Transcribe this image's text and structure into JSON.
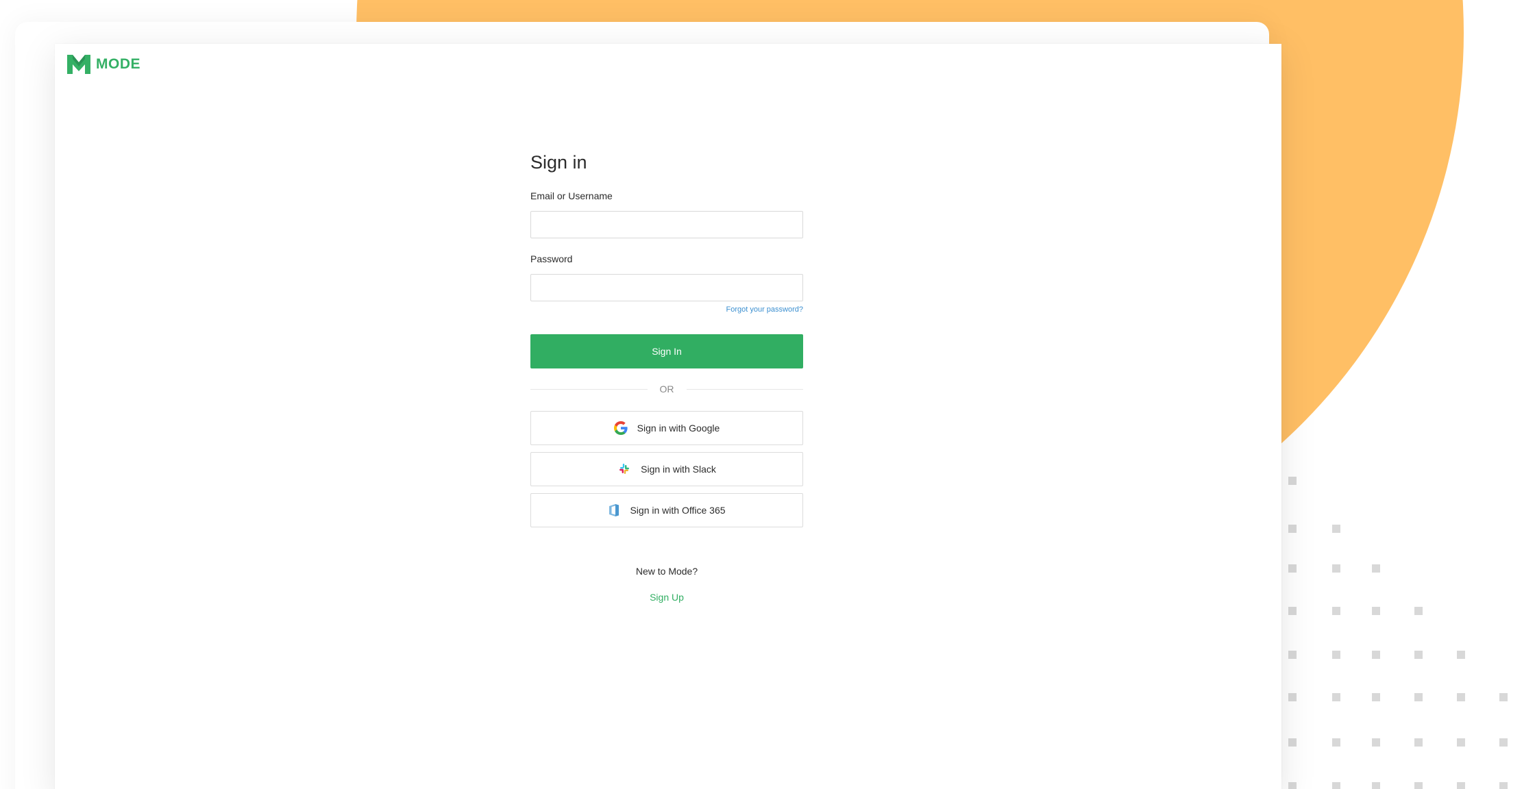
{
  "brand": {
    "name": "MODE",
    "logo_icon": "mode-m-icon",
    "color": "#34b065"
  },
  "sign_in": {
    "title": "Sign in",
    "email_label": "Email or Username",
    "email_value": "",
    "password_label": "Password",
    "password_value": "",
    "forgot_link": "Forgot your password?",
    "submit_label": "Sign In",
    "divider_text": "OR"
  },
  "sso": [
    {
      "label": "Sign in with Google",
      "icon": "google-icon"
    },
    {
      "label": "Sign in with Slack",
      "icon": "slack-icon"
    },
    {
      "label": "Sign in with Office 365",
      "icon": "office-365-icon"
    }
  ],
  "signup": {
    "prompt": "New to Mode?",
    "link": "Sign Up"
  },
  "colors": {
    "accent": "#31ae62",
    "link": "#3b8fd0",
    "background_circle": "#ffbf65"
  }
}
